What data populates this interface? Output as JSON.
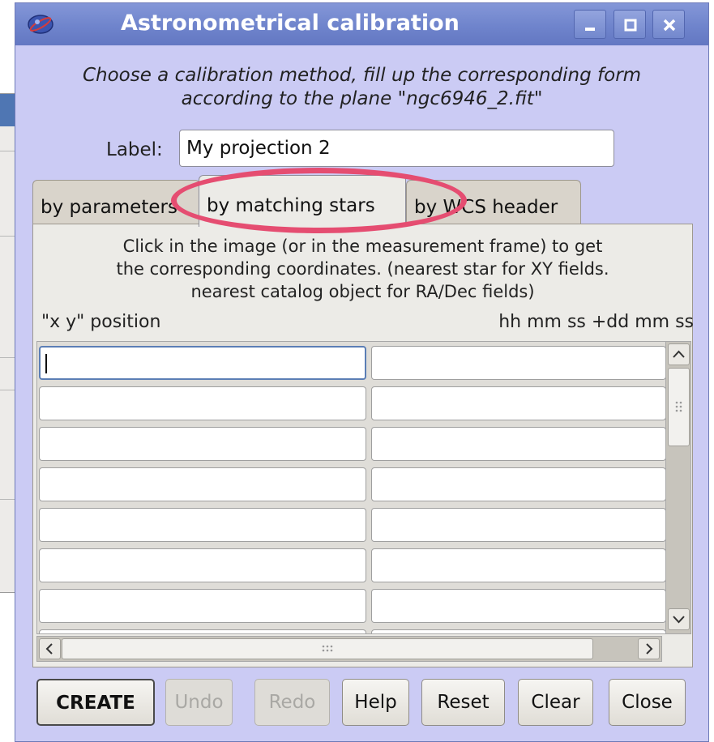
{
  "window": {
    "title": "Astronometrical calibration",
    "controls": [
      "minimize",
      "maximize",
      "close"
    ]
  },
  "intro": {
    "line1": "Choose a calibration method, fill up the corresponding form",
    "line2": "according to the plane \"ngc6946_2.fit\""
  },
  "label_field": {
    "label": "Label:",
    "value": "My projection 2"
  },
  "tabs": [
    {
      "label": "by parameters",
      "active": false
    },
    {
      "label": "by matching stars",
      "active": true
    },
    {
      "label": "by WCS header",
      "active": false
    }
  ],
  "panel": {
    "instructions": [
      "Click in the image (or in the measurement frame) to get",
      "the corresponding coordinates. (nearest star for XY fields.",
      "nearest catalog object for RA/Dec fields)"
    ],
    "col_left": "\"x y\" position",
    "col_right": "hh mm ss +dd mm ss",
    "rows": [
      {
        "xy": "",
        "radec": ""
      },
      {
        "xy": "",
        "radec": ""
      },
      {
        "xy": "",
        "radec": ""
      },
      {
        "xy": "",
        "radec": ""
      },
      {
        "xy": "",
        "radec": ""
      },
      {
        "xy": "",
        "radec": ""
      },
      {
        "xy": "",
        "radec": ""
      },
      {
        "xy": "",
        "radec": ""
      }
    ]
  },
  "buttons": {
    "create": "CREATE",
    "undo": "Undo",
    "redo": "Redo",
    "help": "Help",
    "reset": "Reset",
    "clear": "Clear",
    "close": "Close"
  },
  "colors": {
    "dialog_bg": "#cbcbf4",
    "titlebar": "#7085cc",
    "highlight": "#e54d71"
  }
}
